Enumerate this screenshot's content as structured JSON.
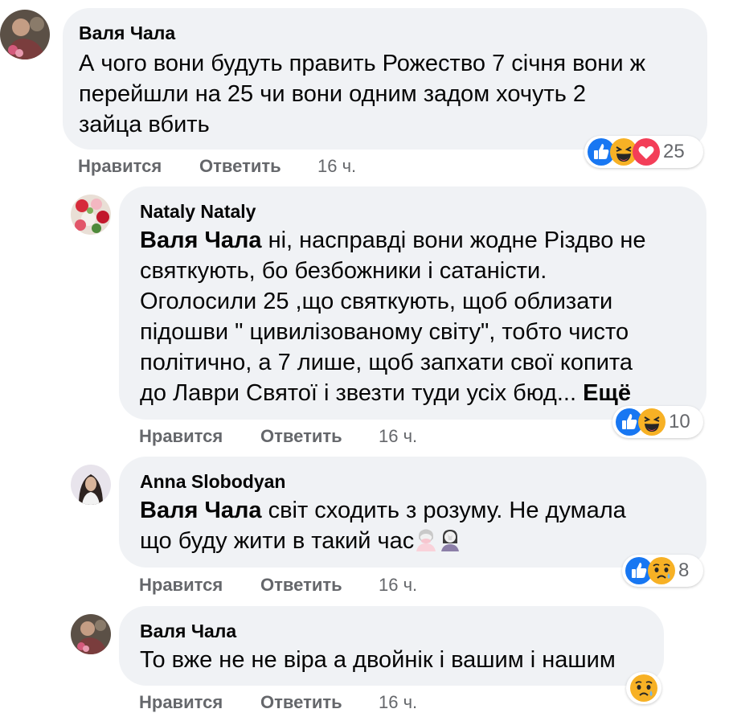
{
  "comments": [
    {
      "author": "Валя Чала",
      "lines": [
        "А чого вони будуть править Рожество 7 січня вони ж",
        "перейшли на 25 чи вони одним задом хочуть 2",
        "зайца вбить"
      ],
      "actions": {
        "like": "Нравится",
        "reply": "Ответить",
        "time": "16 ч."
      },
      "reactions": {
        "icons": [
          "like-icon",
          "haha-icon",
          "love-icon"
        ],
        "count": "25"
      }
    },
    {
      "author": "Nataly Nataly",
      "mention": "Валя Чала",
      "lines": [
        " ні, насправді вони жодне Різдво не",
        "святкують, бо безбожники і сатаністи.",
        "Оголосили 25 ,що святкують, щоб облизати",
        "підошви \" цивилізованому світу\", тобто чисто",
        "політично, а 7 лише, щоб запхати свої копита",
        "до Лаври Святої і звезти туди усіх бюд... "
      ],
      "see_more": "Ещё",
      "actions": {
        "like": "Нравится",
        "reply": "Ответить",
        "time": "16 ч."
      },
      "reactions": {
        "icons": [
          "like-icon",
          "haha-icon"
        ],
        "count": "10"
      }
    },
    {
      "author": "Anna Slobodyan",
      "mention": "Валя Чала",
      "lines": [
        " світ сходить з розуму. Не думала",
        "що буду жити в такий час"
      ],
      "emoji": [
        "woman-hands-over-mouth-emoji",
        "woman-facepalming-emoji"
      ],
      "actions": {
        "like": "Нравится",
        "reply": "Ответить",
        "time": "16 ч."
      },
      "reactions": {
        "icons": [
          "like-icon",
          "sad-icon"
        ],
        "count": "8"
      }
    },
    {
      "author": "Валя Чала",
      "lines": [
        "То вже не не віра а двойнік і вашим і нашим"
      ],
      "actions": {
        "like": "Нравится",
        "reply": "Ответить",
        "time": "16 ч."
      },
      "reactions": {
        "icons": [
          "sad-icon"
        ],
        "count": ""
      }
    }
  ],
  "colors": {
    "bubble": "#f0f2f5",
    "secondary_text": "#65676b",
    "like_blue": "#1877f2",
    "reaction_yellow": "#f7b125",
    "love_red": "#f33e58"
  }
}
